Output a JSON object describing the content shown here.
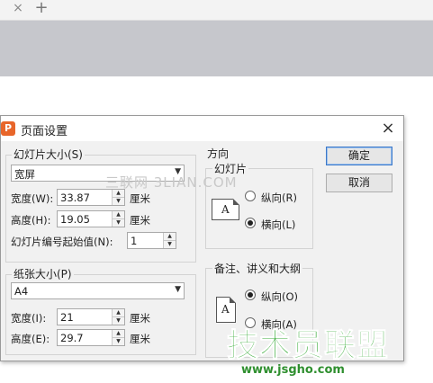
{
  "browser": {
    "close_tab": "×",
    "new_tab": "+"
  },
  "dialog": {
    "title": "页面设置",
    "close": "×",
    "slide_size": {
      "group_label": "幻灯片大小(S)",
      "preset": "宽屏",
      "width_label": "宽度(W):",
      "width_value": "33.87",
      "height_label": "高度(H):",
      "height_value": "19.05",
      "unit": "厘米",
      "start_number_label": "幻灯片编号起始值(N):",
      "start_number_value": "1"
    },
    "paper_size": {
      "group_label": "纸张大小(P)",
      "preset": "A4",
      "width_label": "宽度(I):",
      "width_value": "21",
      "height_label": "高度(E):",
      "height_value": "29.7",
      "unit": "厘米"
    },
    "orientation": {
      "group_label": "方向",
      "slides": {
        "label": "幻灯片",
        "portrait": "纵向(R)",
        "landscape": "横向(L)",
        "selected": "landscape"
      },
      "notes": {
        "label": "备注、讲义和大纲",
        "portrait": "纵向(O)",
        "landscape": "横向(A)",
        "selected": "portrait"
      },
      "icon_letter": "A"
    },
    "ok_label": "确定",
    "cancel_label": "取消"
  },
  "watermark": {
    "site_text": "三联网 3LIAN.COM",
    "brand": "技术员联盟",
    "brand_url": "www.jsgho.com"
  },
  "icons": [
    "close-tab-icon",
    "new-tab-icon",
    "app-logo-icon",
    "close-icon",
    "dropdown-arrow-icon",
    "spinner-up-icon",
    "spinner-down-icon",
    "portrait-page-icon",
    "landscape-page-icon"
  ]
}
